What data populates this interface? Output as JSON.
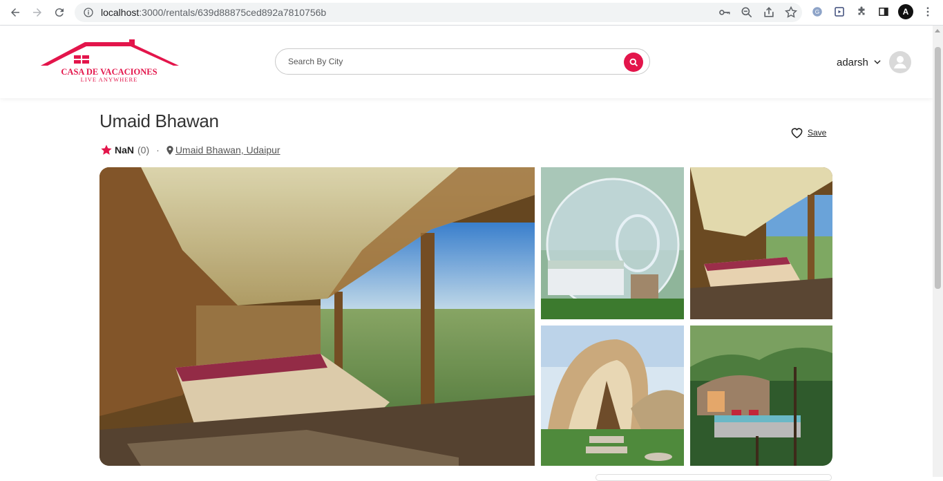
{
  "browser": {
    "url_host": "localhost",
    "url_path": ":3000/rentals/639d88875ced892a7810756b",
    "profile_initial": "A"
  },
  "header": {
    "logo_title": "CASA DE VACACIONES",
    "logo_tagline": "LIVE ANYWHERE",
    "search_placeholder": "Search By City",
    "user_name": "adarsh"
  },
  "listing": {
    "title": "Umaid Bhawan",
    "rating": "NaN",
    "review_count": "(0)",
    "separator": "·",
    "location": "Umaid Bhawan, Udaipur",
    "save_label": "Save"
  },
  "colors": {
    "brand": "#e3154b",
    "text": "#222222"
  }
}
